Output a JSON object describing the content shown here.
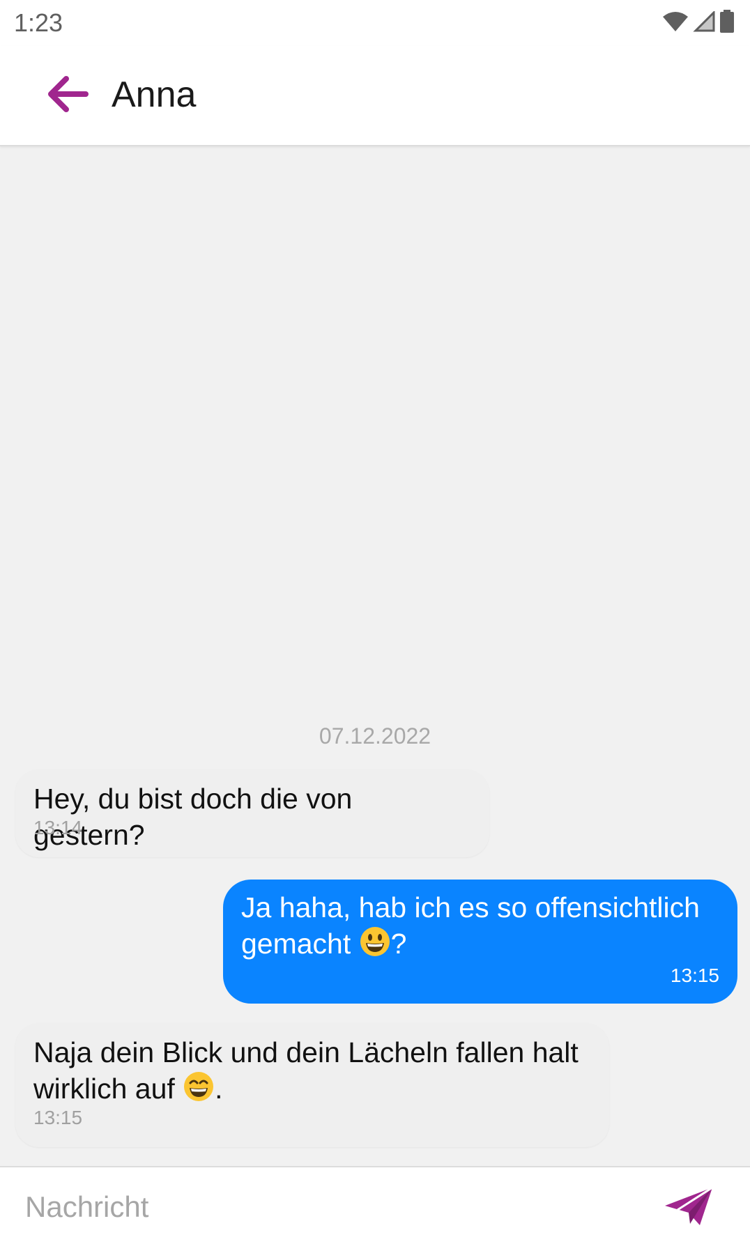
{
  "status_bar": {
    "time": "1:23",
    "icons": [
      "wifi-icon",
      "signal-icon",
      "battery-icon"
    ]
  },
  "header": {
    "back_icon": "arrow-left-icon",
    "contact_name": "Anna"
  },
  "chat": {
    "date_separator": "07.12.2022",
    "messages": [
      {
        "direction": "incoming",
        "text": "Hey, du bist doch die von gestern?",
        "time": "13:14"
      },
      {
        "direction": "outgoing",
        "text_line1": "Ja haha, hab ich es so offensichtlich",
        "text_line2_before": "gemacht ",
        "emoji": "grinning-face-emoji",
        "text_line2_after": "?",
        "time": "13:15"
      },
      {
        "direction": "incoming",
        "text_line1": "Naja dein Blick und dein Lächeln fallen halt",
        "text_line2_before": "wirklich auf ",
        "emoji": "grinning-smiling-eyes-emoji",
        "text_line2_after": ".",
        "time": "13:15"
      }
    ]
  },
  "composer": {
    "placeholder": "Nachricht",
    "value": "",
    "send_icon": "send-icon"
  },
  "colors": {
    "accent": "#a0268e",
    "outgoing_bubble": "#0a84ff",
    "incoming_bubble": "#efefef",
    "background": "#f1f1f1"
  }
}
